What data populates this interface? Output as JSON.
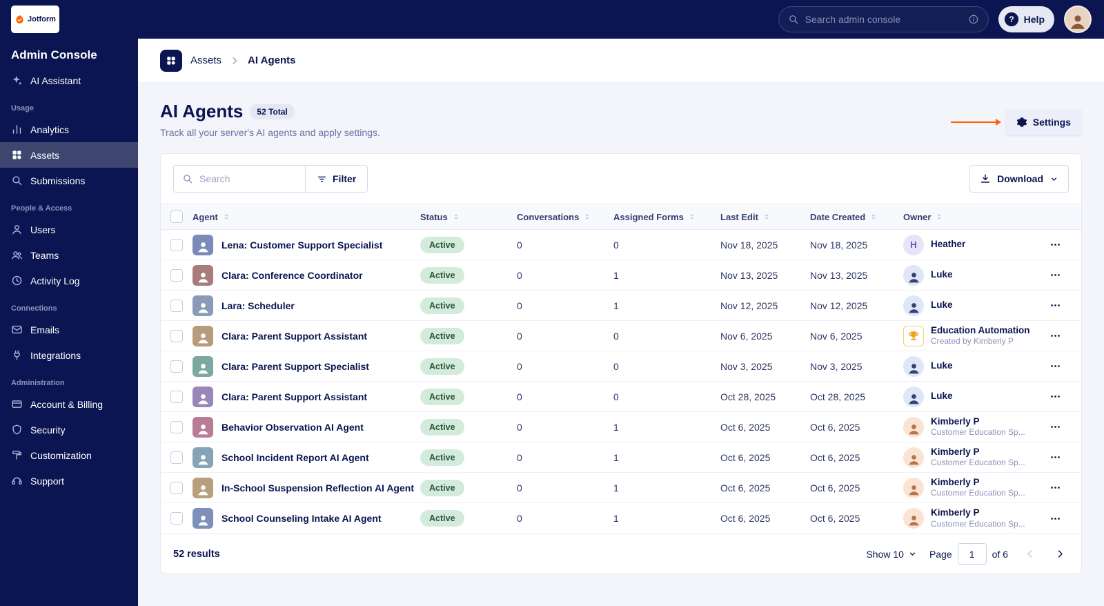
{
  "brand": {
    "logo_text": "Jotform"
  },
  "topbar": {
    "search": {
      "placeholder": "Search admin console"
    },
    "help": {
      "label": "Help"
    }
  },
  "sidebar": {
    "title": "Admin Console",
    "groups": [
      {
        "label": "",
        "items": [
          {
            "label": "AI Assistant",
            "icon": "sparkle-icon",
            "active": false
          }
        ]
      },
      {
        "label": "Usage",
        "items": [
          {
            "label": "Analytics",
            "icon": "bar-chart-icon",
            "active": false
          },
          {
            "label": "Assets",
            "icon": "grid-icon",
            "active": true
          },
          {
            "label": "Submissions",
            "icon": "search-icon",
            "active": false
          }
        ]
      },
      {
        "label": "People & Access",
        "items": [
          {
            "label": "Users",
            "icon": "user-icon",
            "active": false
          },
          {
            "label": "Teams",
            "icon": "users-icon",
            "active": false
          },
          {
            "label": "Activity Log",
            "icon": "clock-icon",
            "active": false
          }
        ]
      },
      {
        "label": "Connections",
        "items": [
          {
            "label": "Emails",
            "icon": "envelope-icon",
            "active": false
          },
          {
            "label": "Integrations",
            "icon": "plug-icon",
            "active": false
          }
        ]
      },
      {
        "label": "Administration",
        "items": [
          {
            "label": "Account & Billing",
            "icon": "card-icon",
            "active": false
          },
          {
            "label": "Security",
            "icon": "shield-icon",
            "active": false
          },
          {
            "label": "Customization",
            "icon": "brush-icon",
            "active": false
          },
          {
            "label": "Support",
            "icon": "support-icon",
            "active": false
          }
        ]
      }
    ]
  },
  "breadcrumb": {
    "items": [
      "Assets",
      "AI Agents"
    ]
  },
  "page": {
    "title": "AI Agents",
    "total_badge": "52 Total",
    "subtitle": "Track all your server's AI agents and apply settings.",
    "settings_button": "Settings"
  },
  "toolbar": {
    "search_placeholder": "Search",
    "filter_label": "Filter",
    "download_label": "Download"
  },
  "table": {
    "columns": [
      "Agent",
      "Status",
      "Conversations",
      "Assigned Forms",
      "Last Edit",
      "Date Created",
      "Owner"
    ],
    "rows": [
      {
        "agent": "Lena: Customer Support Specialist",
        "status": "Active",
        "conversations": "0",
        "assigned_forms": "0",
        "last_edit": "Nov 18, 2025",
        "date_created": "Nov 18, 2025",
        "owner": {
          "name": "Heather",
          "subtitle": "",
          "avatar": "letter",
          "initial": "H"
        }
      },
      {
        "agent": "Clara: Conference Coordinator",
        "status": "Active",
        "conversations": "0",
        "assigned_forms": "1",
        "last_edit": "Nov 13, 2025",
        "date_created": "Nov 13, 2025",
        "owner": {
          "name": "Luke",
          "subtitle": "",
          "avatar": "photo"
        }
      },
      {
        "agent": "Lara: Scheduler",
        "status": "Active",
        "conversations": "0",
        "assigned_forms": "1",
        "last_edit": "Nov 12, 2025",
        "date_created": "Nov 12, 2025",
        "owner": {
          "name": "Luke",
          "subtitle": "",
          "avatar": "photo"
        }
      },
      {
        "agent": "Clara: Parent Support Assistant",
        "status": "Active",
        "conversations": "0",
        "assigned_forms": "0",
        "last_edit": "Nov 6, 2025",
        "date_created": "Nov 6, 2025",
        "owner": {
          "name": "Education Automation",
          "subtitle": "Created by Kimberly P",
          "avatar": "trophy"
        }
      },
      {
        "agent": "Clara: Parent Support Specialist",
        "status": "Active",
        "conversations": "0",
        "assigned_forms": "0",
        "last_edit": "Nov 3, 2025",
        "date_created": "Nov 3, 2025",
        "owner": {
          "name": "Luke",
          "subtitle": "",
          "avatar": "photo"
        }
      },
      {
        "agent": "Clara: Parent Support Assistant",
        "status": "Active",
        "conversations": "0",
        "assigned_forms": "0",
        "last_edit": "Oct 28, 2025",
        "date_created": "Oct 28, 2025",
        "owner": {
          "name": "Luke",
          "subtitle": "",
          "avatar": "photo"
        }
      },
      {
        "agent": "Behavior Observation AI Agent",
        "status": "Active",
        "conversations": "0",
        "assigned_forms": "1",
        "last_edit": "Oct 6, 2025",
        "date_created": "Oct 6, 2025",
        "owner": {
          "name": "Kimberly P",
          "subtitle": "Customer Education Sp...",
          "avatar": "photo"
        }
      },
      {
        "agent": "School Incident Report AI Agent",
        "status": "Active",
        "conversations": "0",
        "assigned_forms": "1",
        "last_edit": "Oct 6, 2025",
        "date_created": "Oct 6, 2025",
        "owner": {
          "name": "Kimberly P",
          "subtitle": "Customer Education Sp...",
          "avatar": "photo"
        }
      },
      {
        "agent": "In-School Suspension Reflection AI Agent",
        "status": "Active",
        "conversations": "0",
        "assigned_forms": "1",
        "last_edit": "Oct 6, 2025",
        "date_created": "Oct 6, 2025",
        "owner": {
          "name": "Kimberly P",
          "subtitle": "Customer Education Sp...",
          "avatar": "photo"
        }
      },
      {
        "agent": "School Counseling Intake AI Agent",
        "status": "Active",
        "conversations": "0",
        "assigned_forms": "1",
        "last_edit": "Oct 6, 2025",
        "date_created": "Oct 6, 2025",
        "owner": {
          "name": "Kimberly P",
          "subtitle": "Customer Education Sp...",
          "avatar": "photo"
        }
      }
    ]
  },
  "pagination": {
    "results": "52 results",
    "show": "Show 10",
    "page_label": "Page",
    "page_value": "1",
    "of_label": "of 6"
  },
  "colors": {
    "accent_orange": "#FF6100",
    "navy": "#0A1551",
    "active_badge_bg": "#D3EBDA"
  }
}
